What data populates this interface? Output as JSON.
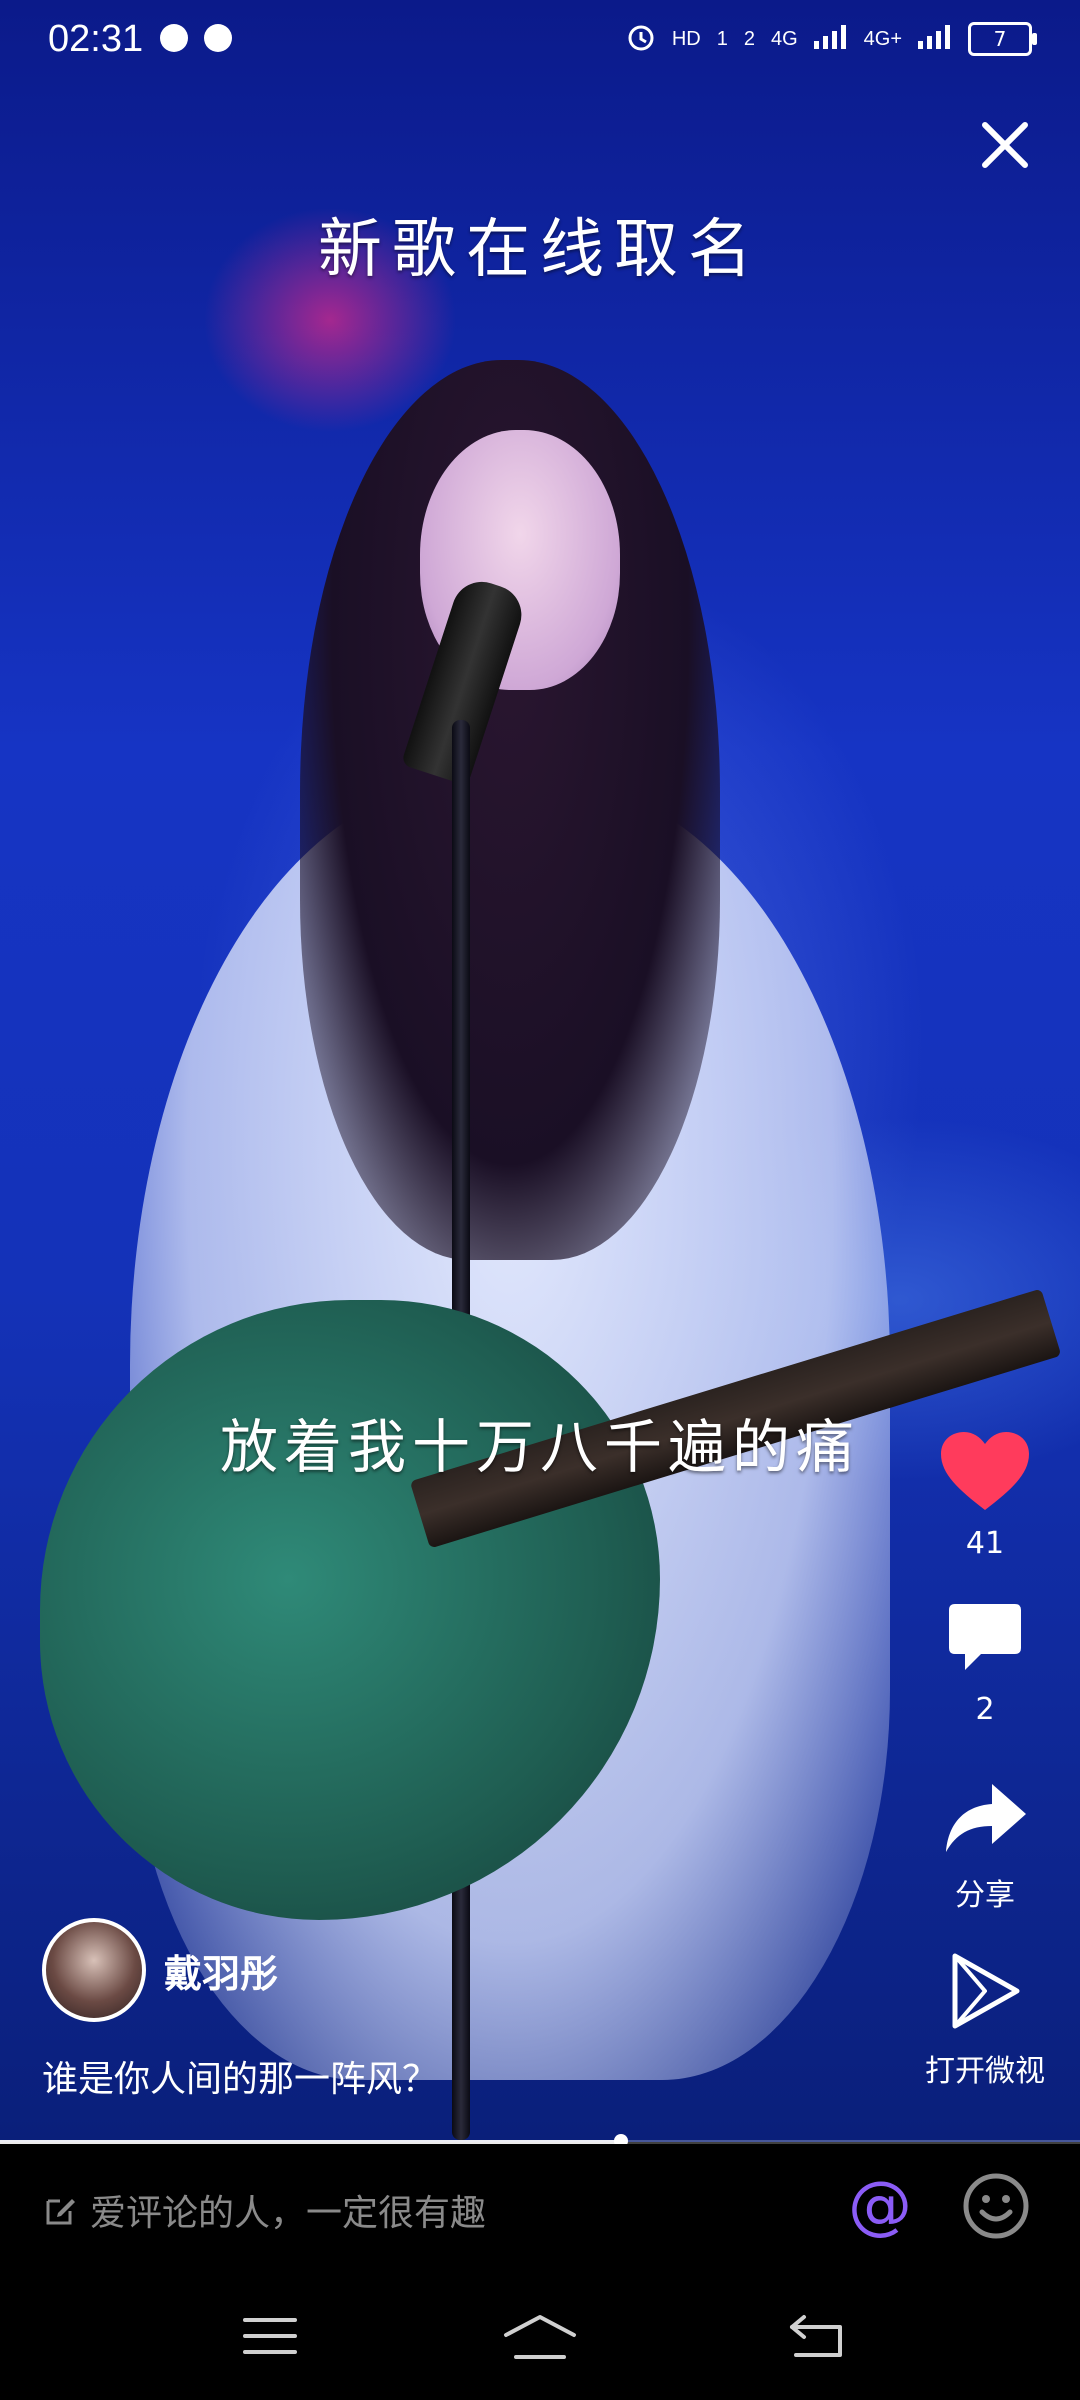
{
  "status_bar": {
    "time": "02:31",
    "indicators": [
      "HD",
      "1",
      "2",
      "4G",
      "4G+"
    ],
    "battery": "7"
  },
  "video": {
    "title_overlay": "新歌在线取名",
    "subtitle_overlay": "放着我十万八千遍的痛",
    "progress_fraction": 0.575
  },
  "actions": {
    "likes": "41",
    "comments": "2",
    "share_label": "分享",
    "open_label": "打开微视"
  },
  "creator": {
    "name": "戴羽彤",
    "caption": "谁是你人间的那一阵风？"
  },
  "comment_bar": {
    "placeholder": "爱评论的人，一定很有趣",
    "at_symbol": "@"
  },
  "colors": {
    "like_heart": "#ff3b5c",
    "at_accent": "#8b5cf6"
  },
  "icons": {
    "close": "close-icon",
    "heart": "heart-icon",
    "comment": "comment-bubble-icon",
    "share": "share-arrow-icon",
    "open_app": "play-triangle-icon",
    "edit": "edit-icon",
    "emoji": "smiley-icon",
    "nav_menu": "menu-icon",
    "nav_home": "home-icon",
    "nav_back": "back-icon"
  }
}
